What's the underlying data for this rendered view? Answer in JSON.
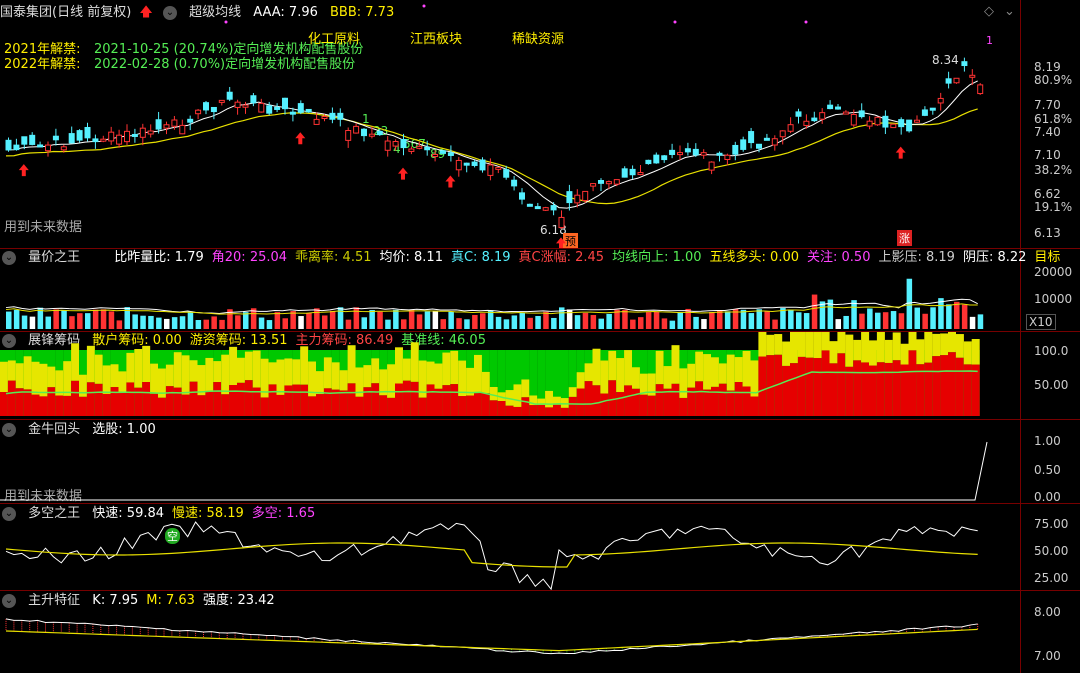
{
  "colors": {
    "up": "#ff3333",
    "down": "#55f0ff",
    "ma_white": "#ffffff",
    "ma_yellow": "#e8e000",
    "grid": "#700000",
    "green": "#00c800",
    "yellow": "#e6e600",
    "red": "#e60000",
    "text_cyan": "#66ddff",
    "text_green": "#55ee55",
    "text_yellow": "#ffee00",
    "text_magenta": "#ff44ff",
    "text_red": "#ff4444"
  },
  "main": {
    "title": "国泰集团(日线 前复权)",
    "indicator": "超级均线",
    "aaa_label": "AAA: 7.96",
    "bbb_label": "BBB: 7.73",
    "unlock1_label": "2021年解禁:",
    "unlock1_value": "2021-10-25 (20.74%)定向增发机构配售股份",
    "unlock2_label": "2022年解禁:",
    "unlock2_value": "2022-02-28 (0.70%)定向增发机构配售股份",
    "concept1": "化工原料",
    "concept2": "江西板块",
    "concept3": "稀缺资源",
    "future_note": "用到未来数据",
    "high_label": "8.34",
    "low_label": "6.18",
    "pre_badge": "预",
    "up_badge": "涨",
    "count_label_1": "1",
    "count_label_2": "23",
    "count_label_3": "4",
    "count_label_4": "567",
    "count_label_5": "89",
    "corner_count": "1",
    "axis": [
      "8.19",
      "80.9%",
      "7.70",
      "61.8%",
      "7.40",
      "7.10",
      "38.2%",
      "6.62",
      "19.1%",
      "6.13"
    ]
  },
  "volume": {
    "title": "量价之王",
    "items": [
      {
        "t": "比昨量比: 1.79",
        "c": "#ffffff"
      },
      {
        "t": "角20: 25.04",
        "c": "#ff44ff"
      },
      {
        "t": "乖离率: 4.51",
        "c": "#cccc00"
      },
      {
        "t": "均价: 8.11",
        "c": "#ffffff"
      },
      {
        "t": "真C: 8.19",
        "c": "#55f0ff"
      },
      {
        "t": "真C涨幅: 2.45",
        "c": "#ff4444"
      },
      {
        "t": "均线向上: 1.00",
        "c": "#55ee55"
      },
      {
        "t": "五线多头: 0.00",
        "c": "#ffee00"
      },
      {
        "t": "关注: 0.50",
        "c": "#ff44ff"
      },
      {
        "t": "上影压: 8.19",
        "c": "#cccccc"
      },
      {
        "t": "阴压: 8.22",
        "c": "#ffffff"
      },
      {
        "t": "目标",
        "c": "#ffee00"
      }
    ],
    "axis": [
      "20000",
      "10000"
    ],
    "unit": "X10"
  },
  "chips": {
    "title": "展锋筹码",
    "items": [
      {
        "t": "散户筹码: 0.00",
        "c": "#ffee00"
      },
      {
        "t": "游资筹码: 13.51",
        "c": "#ffee00"
      },
      {
        "t": "主力筹码: 86.49",
        "c": "#ff4444"
      },
      {
        "t": "基准线: 46.05",
        "c": "#55ee55"
      }
    ],
    "axis": [
      "100.0",
      "50.00"
    ]
  },
  "bull": {
    "title": "金牛回头",
    "items": [
      {
        "t": "选股: 1.00",
        "c": "#ffffff"
      }
    ],
    "future_note": "用到未来数据",
    "axis": [
      "1.00",
      "0.50",
      "0.00"
    ]
  },
  "longshort": {
    "title": "多空之王",
    "items": [
      {
        "t": "快速: 59.84",
        "c": "#ffffff"
      },
      {
        "t": "慢速: 58.19",
        "c": "#ffee00"
      },
      {
        "t": "多空: 1.65",
        "c": "#ff44ff"
      }
    ],
    "badge": "空",
    "axis": [
      "75.00",
      "50.00",
      "25.00"
    ]
  },
  "rise": {
    "title": "主升特征",
    "items": [
      {
        "t": "K: 7.95",
        "c": "#ffffff"
      },
      {
        "t": "M: 7.63",
        "c": "#ffee00"
      },
      {
        "t": "强度: 23.42",
        "c": "#ffffff"
      }
    ],
    "axis": [
      "8.00",
      "7.00"
    ]
  }
}
